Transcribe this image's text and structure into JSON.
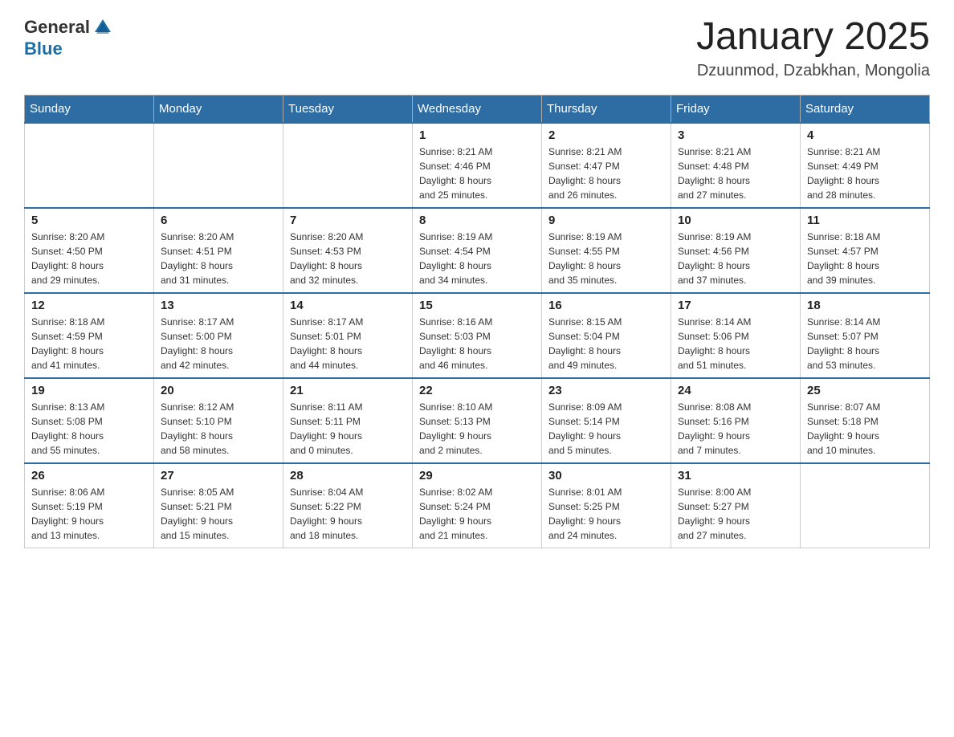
{
  "header": {
    "logo_general": "General",
    "logo_blue": "Blue",
    "title": "January 2025",
    "location": "Dzuunmod, Dzabkhan, Mongolia"
  },
  "days_of_week": [
    "Sunday",
    "Monday",
    "Tuesday",
    "Wednesday",
    "Thursday",
    "Friday",
    "Saturday"
  ],
  "weeks": [
    [
      {
        "day": "",
        "info": ""
      },
      {
        "day": "",
        "info": ""
      },
      {
        "day": "",
        "info": ""
      },
      {
        "day": "1",
        "info": "Sunrise: 8:21 AM\nSunset: 4:46 PM\nDaylight: 8 hours\nand 25 minutes."
      },
      {
        "day": "2",
        "info": "Sunrise: 8:21 AM\nSunset: 4:47 PM\nDaylight: 8 hours\nand 26 minutes."
      },
      {
        "day": "3",
        "info": "Sunrise: 8:21 AM\nSunset: 4:48 PM\nDaylight: 8 hours\nand 27 minutes."
      },
      {
        "day": "4",
        "info": "Sunrise: 8:21 AM\nSunset: 4:49 PM\nDaylight: 8 hours\nand 28 minutes."
      }
    ],
    [
      {
        "day": "5",
        "info": "Sunrise: 8:20 AM\nSunset: 4:50 PM\nDaylight: 8 hours\nand 29 minutes."
      },
      {
        "day": "6",
        "info": "Sunrise: 8:20 AM\nSunset: 4:51 PM\nDaylight: 8 hours\nand 31 minutes."
      },
      {
        "day": "7",
        "info": "Sunrise: 8:20 AM\nSunset: 4:53 PM\nDaylight: 8 hours\nand 32 minutes."
      },
      {
        "day": "8",
        "info": "Sunrise: 8:19 AM\nSunset: 4:54 PM\nDaylight: 8 hours\nand 34 minutes."
      },
      {
        "day": "9",
        "info": "Sunrise: 8:19 AM\nSunset: 4:55 PM\nDaylight: 8 hours\nand 35 minutes."
      },
      {
        "day": "10",
        "info": "Sunrise: 8:19 AM\nSunset: 4:56 PM\nDaylight: 8 hours\nand 37 minutes."
      },
      {
        "day": "11",
        "info": "Sunrise: 8:18 AM\nSunset: 4:57 PM\nDaylight: 8 hours\nand 39 minutes."
      }
    ],
    [
      {
        "day": "12",
        "info": "Sunrise: 8:18 AM\nSunset: 4:59 PM\nDaylight: 8 hours\nand 41 minutes."
      },
      {
        "day": "13",
        "info": "Sunrise: 8:17 AM\nSunset: 5:00 PM\nDaylight: 8 hours\nand 42 minutes."
      },
      {
        "day": "14",
        "info": "Sunrise: 8:17 AM\nSunset: 5:01 PM\nDaylight: 8 hours\nand 44 minutes."
      },
      {
        "day": "15",
        "info": "Sunrise: 8:16 AM\nSunset: 5:03 PM\nDaylight: 8 hours\nand 46 minutes."
      },
      {
        "day": "16",
        "info": "Sunrise: 8:15 AM\nSunset: 5:04 PM\nDaylight: 8 hours\nand 49 minutes."
      },
      {
        "day": "17",
        "info": "Sunrise: 8:14 AM\nSunset: 5:06 PM\nDaylight: 8 hours\nand 51 minutes."
      },
      {
        "day": "18",
        "info": "Sunrise: 8:14 AM\nSunset: 5:07 PM\nDaylight: 8 hours\nand 53 minutes."
      }
    ],
    [
      {
        "day": "19",
        "info": "Sunrise: 8:13 AM\nSunset: 5:08 PM\nDaylight: 8 hours\nand 55 minutes."
      },
      {
        "day": "20",
        "info": "Sunrise: 8:12 AM\nSunset: 5:10 PM\nDaylight: 8 hours\nand 58 minutes."
      },
      {
        "day": "21",
        "info": "Sunrise: 8:11 AM\nSunset: 5:11 PM\nDaylight: 9 hours\nand 0 minutes."
      },
      {
        "day": "22",
        "info": "Sunrise: 8:10 AM\nSunset: 5:13 PM\nDaylight: 9 hours\nand 2 minutes."
      },
      {
        "day": "23",
        "info": "Sunrise: 8:09 AM\nSunset: 5:14 PM\nDaylight: 9 hours\nand 5 minutes."
      },
      {
        "day": "24",
        "info": "Sunrise: 8:08 AM\nSunset: 5:16 PM\nDaylight: 9 hours\nand 7 minutes."
      },
      {
        "day": "25",
        "info": "Sunrise: 8:07 AM\nSunset: 5:18 PM\nDaylight: 9 hours\nand 10 minutes."
      }
    ],
    [
      {
        "day": "26",
        "info": "Sunrise: 8:06 AM\nSunset: 5:19 PM\nDaylight: 9 hours\nand 13 minutes."
      },
      {
        "day": "27",
        "info": "Sunrise: 8:05 AM\nSunset: 5:21 PM\nDaylight: 9 hours\nand 15 minutes."
      },
      {
        "day": "28",
        "info": "Sunrise: 8:04 AM\nSunset: 5:22 PM\nDaylight: 9 hours\nand 18 minutes."
      },
      {
        "day": "29",
        "info": "Sunrise: 8:02 AM\nSunset: 5:24 PM\nDaylight: 9 hours\nand 21 minutes."
      },
      {
        "day": "30",
        "info": "Sunrise: 8:01 AM\nSunset: 5:25 PM\nDaylight: 9 hours\nand 24 minutes."
      },
      {
        "day": "31",
        "info": "Sunrise: 8:00 AM\nSunset: 5:27 PM\nDaylight: 9 hours\nand 27 minutes."
      },
      {
        "day": "",
        "info": ""
      }
    ]
  ]
}
